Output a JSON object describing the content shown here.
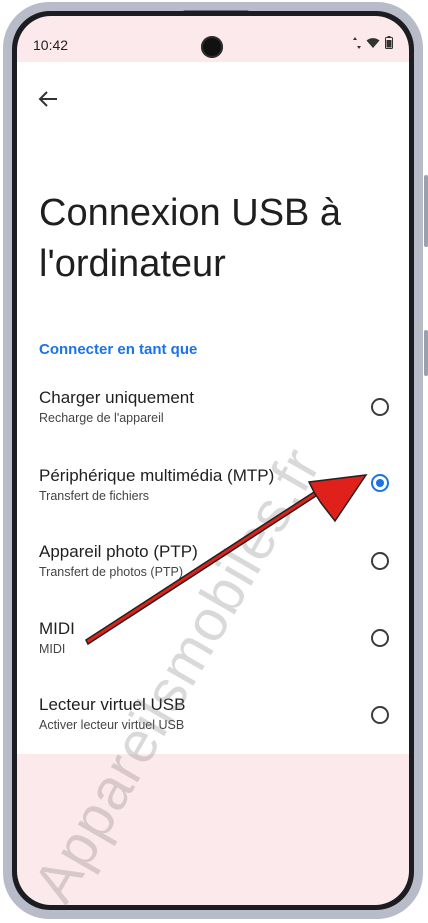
{
  "status_bar": {
    "time": "10:42"
  },
  "header": {
    "title": "Connexion USB à l'ordinateur"
  },
  "section": {
    "label": "Connecter en tant que"
  },
  "options": [
    {
      "title": "Charger uniquement",
      "subtitle": "Recharge de l'appareil",
      "selected": false
    },
    {
      "title": "Périphérique multimédia (MTP)",
      "subtitle": "Transfert de fichiers",
      "selected": true
    },
    {
      "title": "Appareil photo (PTP)",
      "subtitle": "Transfert de photos (PTP)",
      "selected": false
    },
    {
      "title": "MIDI",
      "subtitle": "MIDI",
      "selected": false
    },
    {
      "title": "Lecteur virtuel USB",
      "subtitle": "Activer lecteur virtuel USB",
      "selected": false
    }
  ],
  "watermark": "Appareilsmobiles.fr",
  "colors": {
    "accent": "#1a73e8",
    "arrow": "#e0201b",
    "screen_bg": "#fce9ec"
  },
  "icons": {
    "back": "arrow-left-icon",
    "wifi": "wifi-icon",
    "battery": "battery-icon",
    "data": "data-arrows-icon"
  }
}
